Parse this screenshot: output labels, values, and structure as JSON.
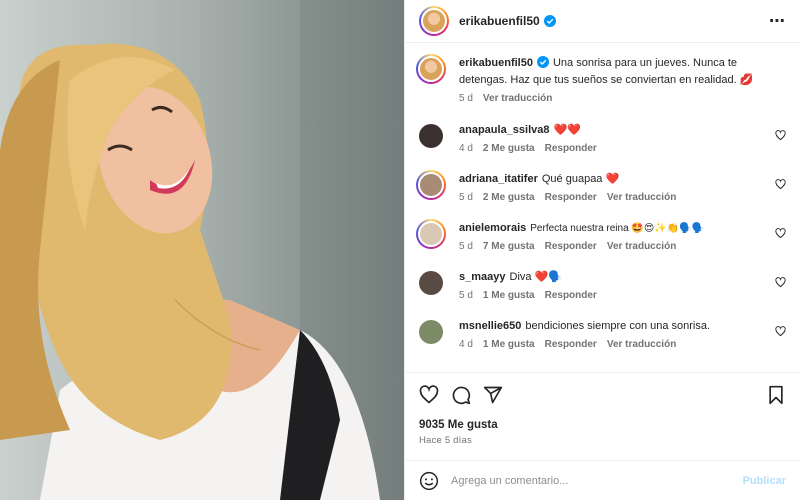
{
  "post": {
    "username": "erikabuenfil50",
    "more_icon": "⋯"
  },
  "caption": {
    "username": "erikabuenfil50",
    "text": "Una sonrisa para un jueves. Nunca te detengas. Haz que tus sueños se conviertan en realidad. 💋",
    "time": "5 d",
    "translate": "Ver traducción"
  },
  "comments": [
    {
      "username": "anapaula_ssilva8",
      "text": "❤️❤️",
      "time": "4 d",
      "likes": "2 Me gusta",
      "reply": "Responder",
      "translate": "",
      "avatar_color": "#3b3030"
    },
    {
      "username": "adriana_itatifer",
      "text": "Qué guapaa ❤️",
      "time": "5 d",
      "likes": "2 Me gusta",
      "reply": "Responder",
      "translate": "Ver traducción",
      "avatar_color": "#a88a75"
    },
    {
      "username": "anielemorais",
      "text": "Perfecta nuestra reina 🤩😍✨👏🗣️🗣️",
      "time": "5 d",
      "likes": "7 Me gusta",
      "reply": "Responder",
      "translate": "Ver traducción",
      "avatar_color": "#d9c8b4"
    },
    {
      "username": "s_maayy",
      "text": "Diva ❤️🗣️",
      "time": "5 d",
      "likes": "1 Me gusta",
      "reply": "Responder",
      "translate": "",
      "avatar_color": "#5a4a44"
    },
    {
      "username": "msnellie650",
      "text": "bendiciones siempre con una sonrisa.",
      "time": "4 d",
      "likes": "1 Me gusta",
      "reply": "Responder",
      "translate": "Ver traducción",
      "avatar_color": "#7d8a66"
    }
  ],
  "stats": {
    "likes": "9035 Me gusta",
    "ago": "Hace 5 días"
  },
  "add_comment": {
    "placeholder": "Agrega un comentario...",
    "publish": "Publicar"
  },
  "colors": {
    "verified": "#0095f6",
    "heart_red": "#ed4956",
    "publish_disabled": "#b2dffc"
  }
}
